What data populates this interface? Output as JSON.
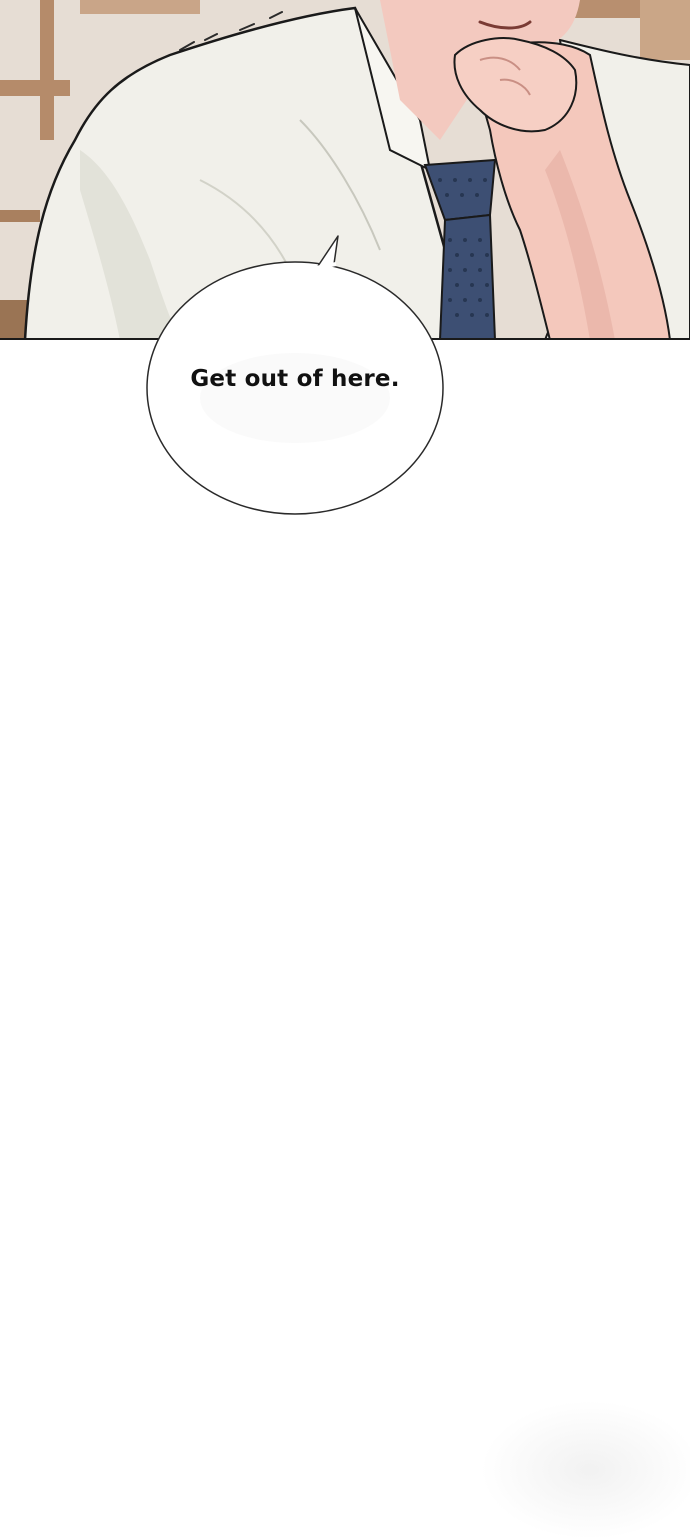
{
  "speech_bubble": {
    "text": "Get out of here."
  },
  "panel": {
    "scene": "man-in-shirt-and-tie-resting-chin-on-fist"
  },
  "colors": {
    "shirt": "#f1f0ea",
    "tie": "#3d4f73",
    "skin": "#f3c9bf",
    "background_wall": "#e4dcd3",
    "wood_frame": "#b58b6a",
    "outline": "#1a1a1a"
  }
}
